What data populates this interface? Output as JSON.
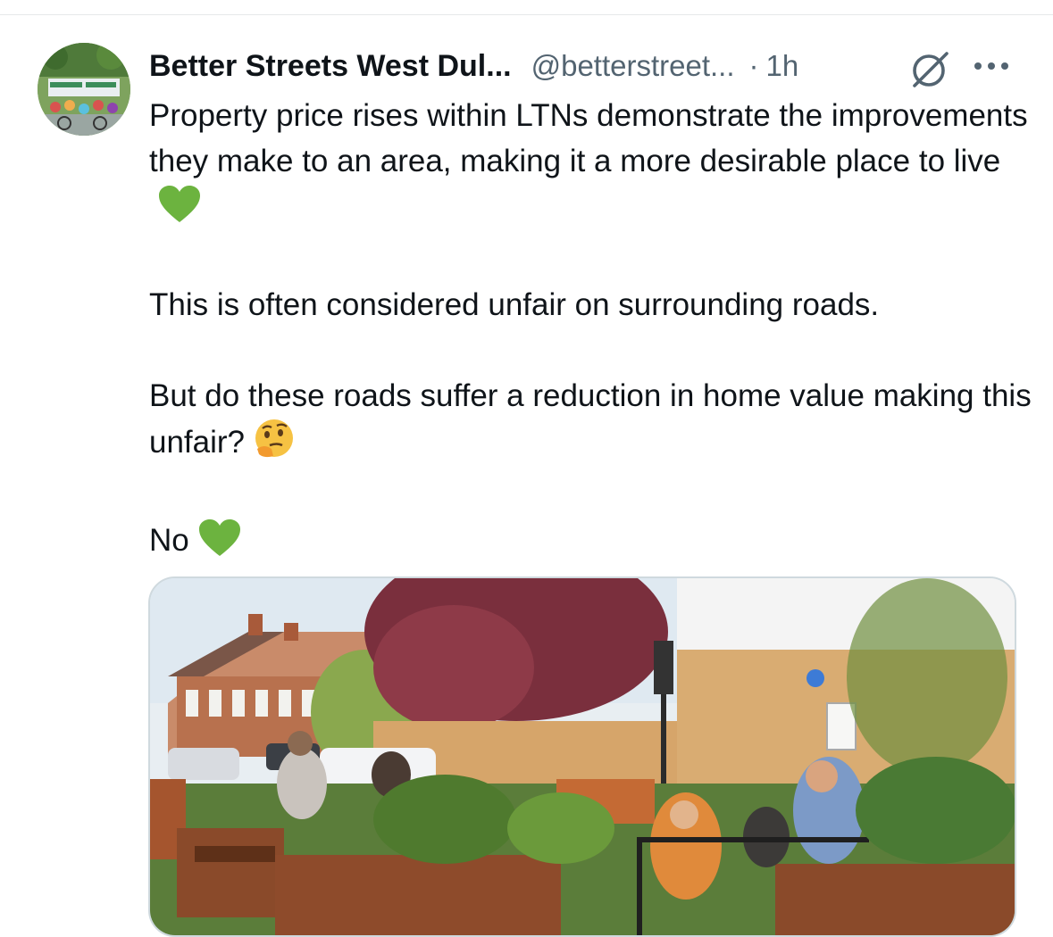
{
  "post": {
    "display_name": "Better Streets West Dul...",
    "handle": "@betterstreet...",
    "separator": "·",
    "time": "1h",
    "paragraphs": [
      "Property price rises within LTNs demonstrate the improvements they make to an area, making it a more desirable place to live",
      "This is often considered unfair on surrounding roads.",
      "But do these roads suffer a reduction in home value making this unfair?",
      "No"
    ],
    "emojis": [
      "green-heart",
      "thinking-face",
      "green-heart"
    ],
    "icons": {
      "grok": "grok-icon",
      "more": "more-options-icon"
    },
    "media": {
      "type": "photo",
      "subject": "street-planters-seating-scene"
    }
  },
  "colors": {
    "text": "#0f1419",
    "secondary_text": "#536471",
    "border": "#cfd9de",
    "heart": "#6cb33f"
  }
}
